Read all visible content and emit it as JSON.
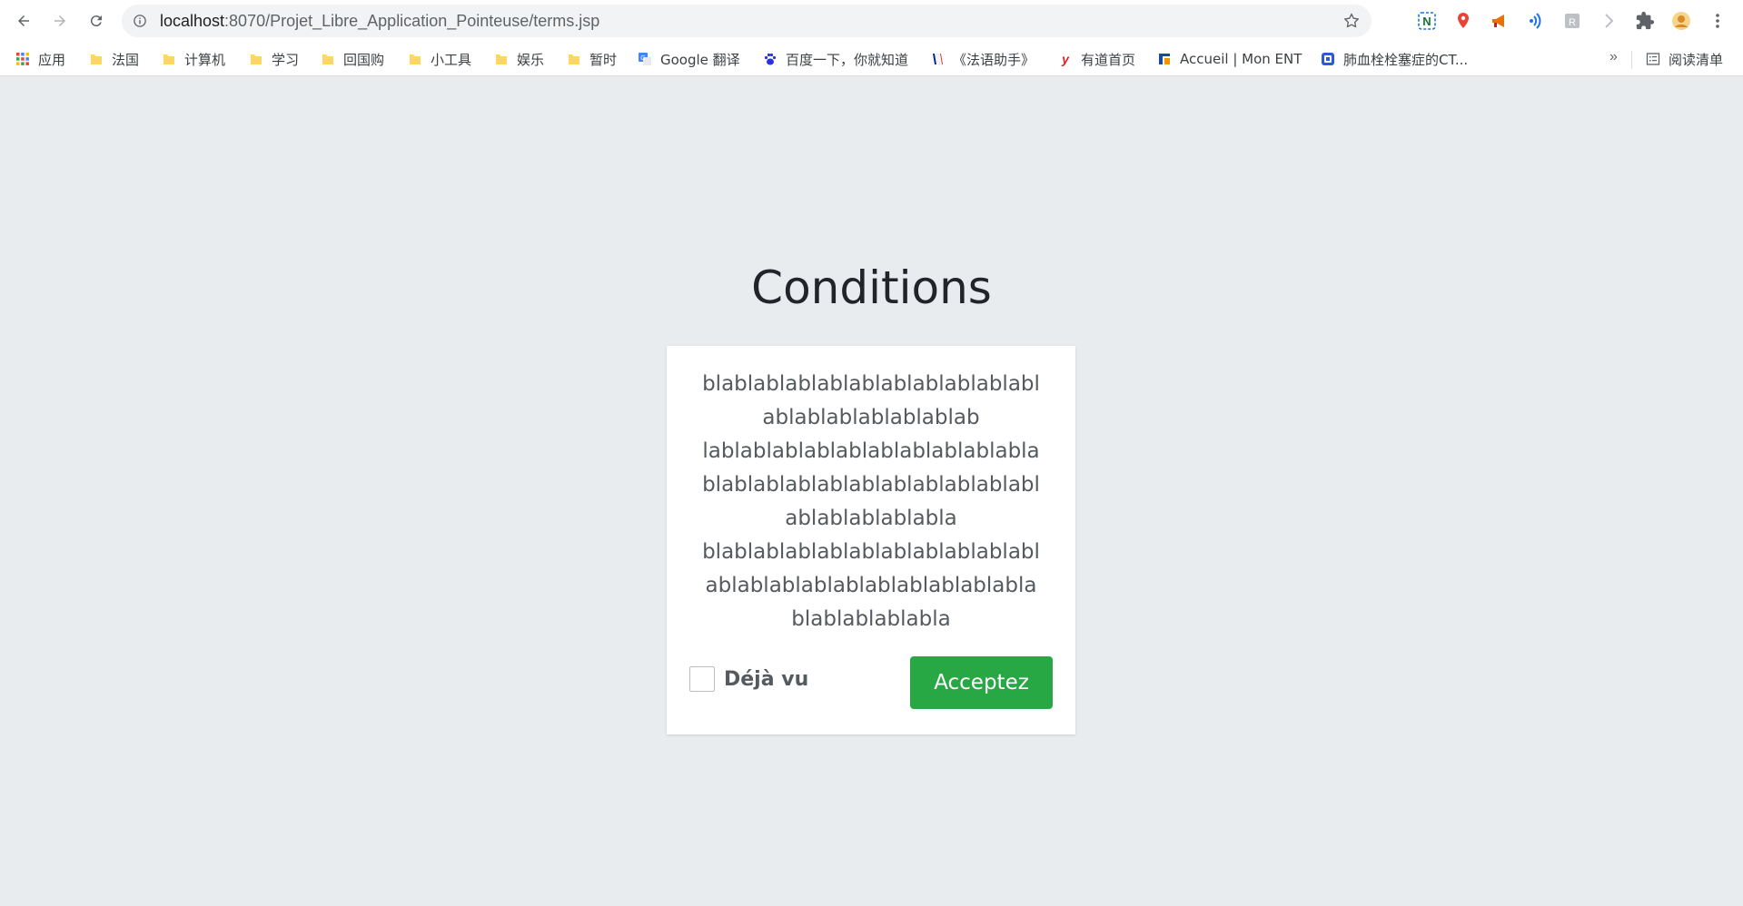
{
  "browser": {
    "url_host": "localhost",
    "url_rest": ":8070/Projet_Libre_Application_Pointeuse/terms.jsp",
    "icons": {
      "back": "arrow-left-icon",
      "forward": "arrow-right-icon",
      "reload": "reload-icon",
      "info": "info-icon",
      "bookmark_star": "star-icon",
      "extensions": "puzzle-icon",
      "menu": "kebab-menu-icon"
    }
  },
  "bookmarks": {
    "items": [
      {
        "label": "应用",
        "icon": "apps-grid-icon"
      },
      {
        "label": "法国",
        "icon": "folder-icon"
      },
      {
        "label": "计算机",
        "icon": "folder-icon"
      },
      {
        "label": "学习",
        "icon": "folder-icon"
      },
      {
        "label": "回国购",
        "icon": "folder-icon"
      },
      {
        "label": "小工具",
        "icon": "folder-icon"
      },
      {
        "label": "娱乐",
        "icon": "folder-icon"
      },
      {
        "label": "暂时",
        "icon": "folder-icon"
      },
      {
        "label": "Google 翻译",
        "icon": "google-translate-icon"
      },
      {
        "label": "百度一下，你就知道",
        "icon": "baidu-paw-icon"
      },
      {
        "label": "《法语助手》",
        "icon": "french-flag-icon"
      },
      {
        "label": "有道首页",
        "icon": "youdao-icon"
      },
      {
        "label": "Accueil | Mon ENT",
        "icon": "ent-icon"
      },
      {
        "label": "肺血栓栓塞症的CT...",
        "icon": "site-icon"
      }
    ],
    "more": "»",
    "reading_list": "阅读清单"
  },
  "page": {
    "title": "Conditions",
    "terms_lines": [
      "blablablablablablablablablablabl",
      "ablablablablablablab",
      "lablablablablablablablablablabla",
      "blablablablablablablablablablabl",
      "ablablablablabla",
      "blablablablablablablablablablabl",
      "ablablablablablablablablablabla",
      "blablablablabla"
    ],
    "checkbox_label": "Déjà vu",
    "checkbox_checked": false,
    "accept_label": "Acceptez"
  },
  "colors": {
    "page_background": "#e9ecef",
    "accept_button": "#28a745",
    "text": "#555a5f"
  }
}
